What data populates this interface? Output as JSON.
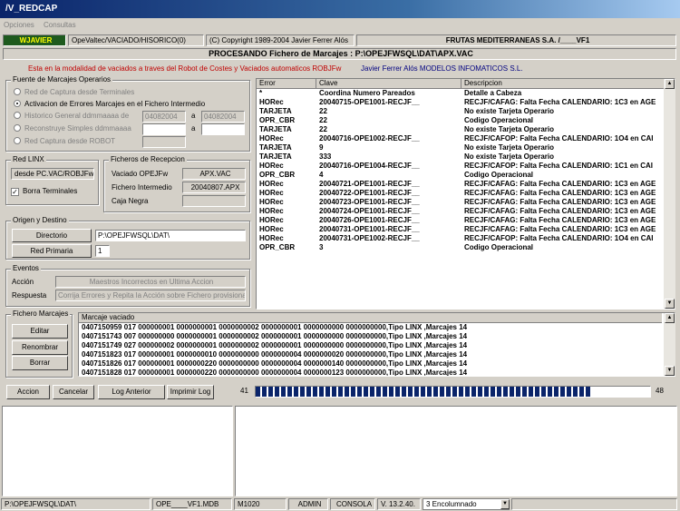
{
  "window": {
    "title": "/V_REDCAP"
  },
  "menu": {
    "items": [
      "Opciones",
      "Consultas"
    ]
  },
  "header": {
    "user": "WJAVIER",
    "module": "OpeValtec/VACIADO/HISORICO(0)",
    "copyright": "(C) Copyright 1989-2004 Javier Ferrer Alós",
    "company": "FRUTAS MEDITERRANEAS S.A. /____VF1",
    "processing": "PROCESANDO Fichero de Marcajes : P:\\OPEJFWSQL\\DAT\\APX.VAC",
    "mode_info": "Esta en la modalidad de vaciados a traves del Robot de Costes y Vaciados automaticos ROBJFw",
    "author_info": "Javier Ferrer Alós MODELOS INFOMATICOS S.L."
  },
  "fuente": {
    "title": "Fuente de Marcajes Operarios",
    "options": [
      {
        "label": "Red de Captura desde Terminales",
        "checked": false,
        "disabled": true
      },
      {
        "label": "Activacion de Errores Marcajes en el Fichero Intermedio",
        "checked": true,
        "disabled": false
      },
      {
        "label": "Historico General ddmmaaaa de",
        "checked": false,
        "disabled": true
      },
      {
        "label": "Reconstruye Simples ddmmaaaa",
        "checked": false,
        "disabled": true
      },
      {
        "label": "Red Captura desde ROBOT",
        "checked": false,
        "disabled": true
      }
    ],
    "hist_from": "04082004",
    "hist_sep": "a",
    "hist_to": "04082004",
    "recon_sep": "a"
  },
  "red_linx": {
    "title": "Red LINX",
    "path": "desde PC.VAC/ROBJFw",
    "borra_label": "Borra Terminales",
    "borra_checked": true
  },
  "recepcion": {
    "title": "Ficheros de Recepcion",
    "vaciado_label": "Vaciado OPEJFw",
    "vaciado_value": "APX.VAC",
    "intermedio_label": "Fichero Intermedio",
    "intermedio_value": "20040807.APX",
    "caja_label": "Caja Negra",
    "caja_value": ""
  },
  "origen": {
    "title": "Origen y Destino",
    "directorio_label": "Directorio",
    "directorio_value": "P:\\OPEJFWSQL\\DAT\\",
    "red_label": "Red Primaria",
    "red_value": "1"
  },
  "eventos": {
    "title": "Eventos",
    "accion_label": "Acción",
    "accion_value": "Maestros Incorrectos en Ultima Accion",
    "respuesta_label": "Respuesta",
    "respuesta_value": "Corrija Errores y Repita la Acción sobre Fichero provisional"
  },
  "errors_grid": {
    "headers": [
      "Error",
      "Clave",
      "Descripcion"
    ],
    "rows": [
      [
        "*",
        "Coordina Numero Pareados",
        "Detalle a Cabeza"
      ],
      [
        "HORec",
        "20040715-OPE1001-RECJF__",
        "RECJF/CAFAG: Falta Fecha CALENDARIO: 1C3 en AGE"
      ],
      [
        "TARJETA",
        "22",
        "No existe Tarjeta Operario"
      ],
      [
        "OPR_CBR",
        "22",
        "Codigo Operacional"
      ],
      [
        "TARJETA",
        "22",
        "No existe Tarjeta Operario"
      ],
      [
        "HORec",
        "20040716-OPE1002-RECJF__",
        "RECJF/CAFOP: Falta Fecha CALENDARIO: 1O4  en CAI"
      ],
      [
        "TARJETA",
        "9",
        "No existe Tarjeta Operario"
      ],
      [
        "TARJETA",
        "333",
        "No existe Tarjeta Operario"
      ],
      [
        "HORec",
        "20040716-OPE1004-RECJF__",
        "RECJF/CAFOP: Falta Fecha CALENDARIO: 1C1  en CAI"
      ],
      [
        "OPR_CBR",
        "4",
        "Codigo Operacional"
      ],
      [
        "HORec",
        "20040721-OPE1001-RECJF__",
        "RECJF/CAFAG: Falta Fecha CALENDARIO: 1C3 en AGE"
      ],
      [
        "HORec",
        "20040722-OPE1001-RECJF__",
        "RECJF/CAFAG: Falta Fecha CALENDARIO: 1C3 en AGE"
      ],
      [
        "HORec",
        "20040723-OPE1001-RECJF__",
        "RECJF/CAFAG: Falta Fecha CALENDARIO: 1C3 en AGE"
      ],
      [
        "HORec",
        "20040724-OPE1001-RECJF__",
        "RECJF/CAFAG: Falta Fecha CALENDARIO: 1C3 en AGE"
      ],
      [
        "HORec",
        "20040726-OPE1001-RECJF__",
        "RECJF/CAFAG: Falta Fecha CALENDARIO: 1C3 en AGE"
      ],
      [
        "HORec",
        "20040731-OPE1001-RECJF__",
        "RECJF/CAFAG: Falta Fecha CALENDARIO: 1C3 en AGE"
      ],
      [
        "HORec",
        "20040731-OPE1002-RECJF__",
        "RECJF/CAFOP: Falta Fecha CALENDARIO: 1O4  en CAI"
      ],
      [
        "OPR_CBR",
        "3",
        "Codigo Operacional"
      ]
    ]
  },
  "fichero": {
    "title": "Fichero Marcajes",
    "editar": "Editar",
    "renombrar": "Renombrar",
    "borrar": "Borrar",
    "grid_header": "Marcaje vaciado",
    "rows": [
      "0407150959 017 000000001 0000000001 0000000002 0000000001 0000000000 0000000000,Tipo LINX ,Marcajes 14",
      "0407151743 007 000000000 0000000001 0000000002 0000000001 0000000000 0000000000,Tipo LINX ,Marcajes 14",
      "0407151749 027 000000002 0000000001 0000000002 0000000001 0000000000 0000000000,Tipo LINX ,Marcajes 14",
      "0407151823 017 000000001 0000000010 0000000000 0000000004 0000000020 0000000000,Tipo LINX ,Marcajes 14",
      "0407151826 017 000000001 0000000220 0000000000 0000000004 0000000140 0000000000,Tipo LINX ,Marcajes 14",
      "0407151828 017 000000001 0000000220 0000000000 0000000004 0000000123 0000000000,Tipo LINX ,Marcajes 14"
    ]
  },
  "toolbar": {
    "accion": "Accion",
    "cancelar": "Cancelar",
    "log_anterior": "Log Anterior",
    "imprimir_log": "Imprimir Log",
    "progress_left": "41",
    "progress_right": "48",
    "progress_fraction": 0.854
  },
  "status": {
    "path": "P:\\OPEJFWSQL\\DAT\\",
    "db": "OPE____VF1.MDB",
    "machine": "M1020",
    "user": "ADMIN",
    "mode": "CONSOLA",
    "version": "V. 13.2.40.",
    "columns": "3 Encolumnado"
  }
}
